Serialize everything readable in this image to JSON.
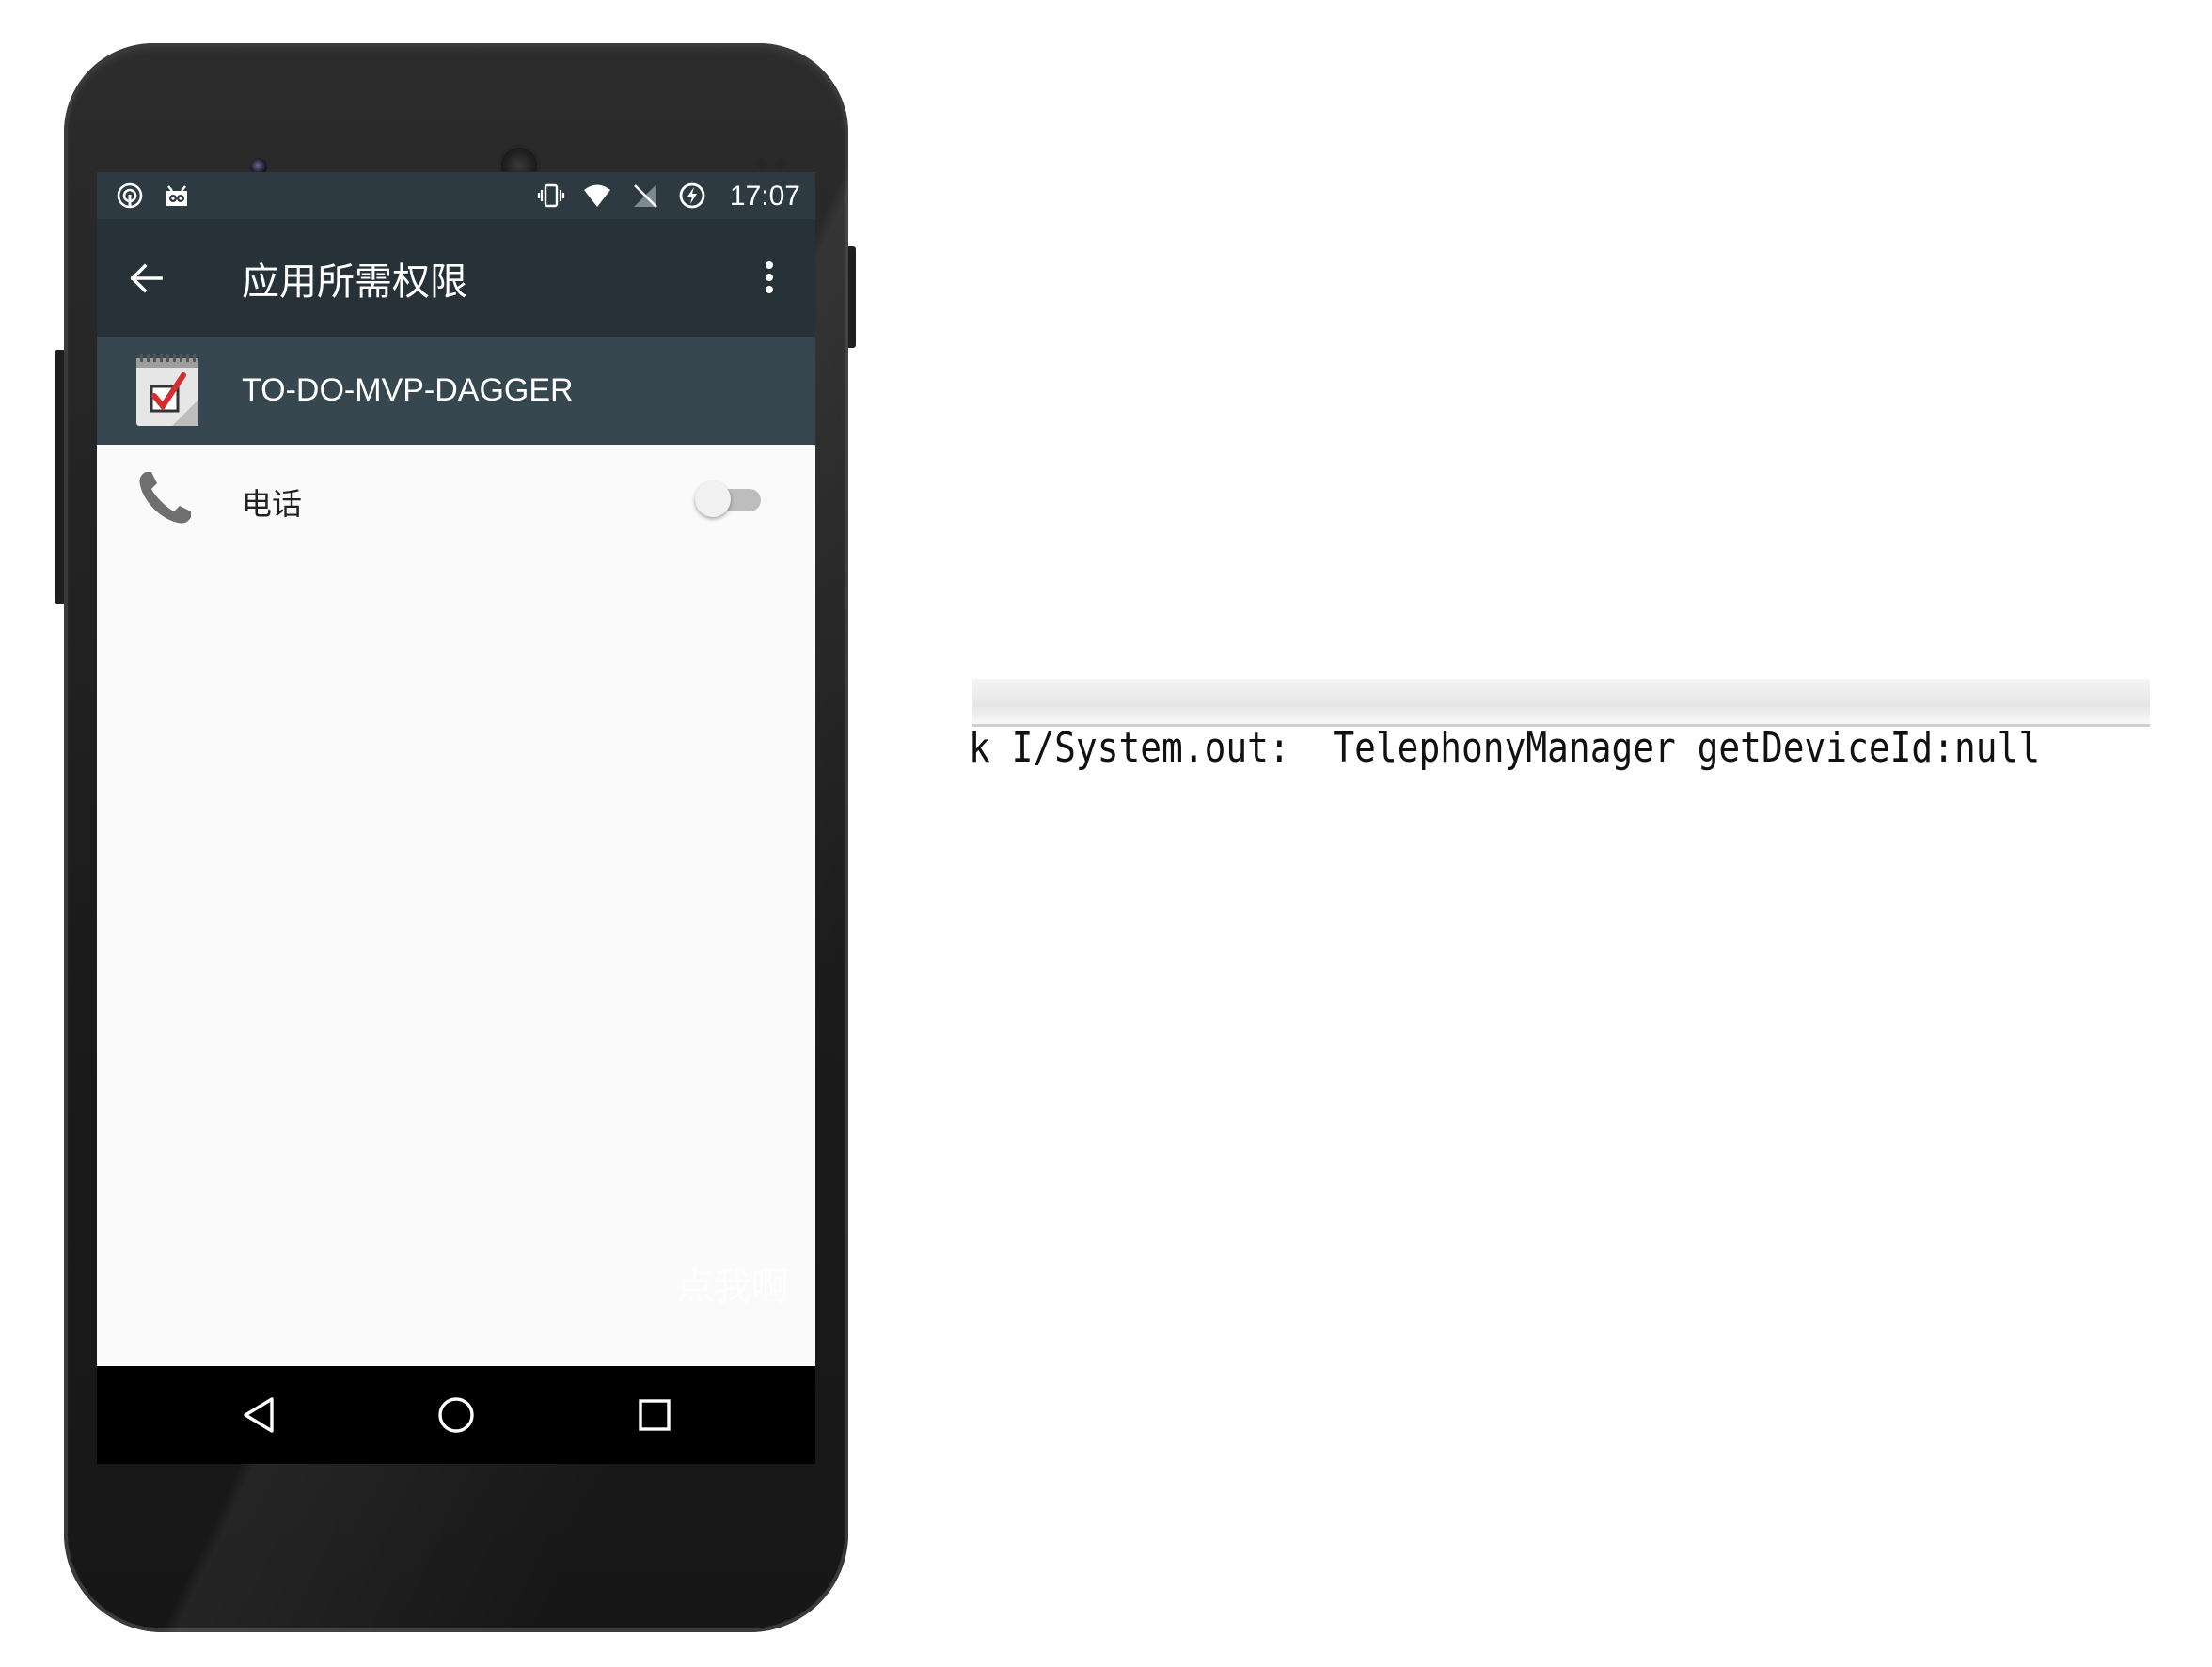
{
  "status_bar": {
    "left_icons": [
      "hotspot-icon",
      "android-debug-icon"
    ],
    "right_icons": [
      "vibrate-icon",
      "wifi-icon",
      "no-sim-icon",
      "data-saver-icon"
    ],
    "time": "17:07"
  },
  "toolbar": {
    "title": "应用所需权限",
    "back_icon": "arrow-left-icon",
    "overflow_icon": "more-vert-icon"
  },
  "app": {
    "name": "TO-DO-MVP-DAGGER",
    "icon": "checklist-app-icon"
  },
  "permissions": [
    {
      "label": "电话",
      "icon": "phone-icon",
      "enabled": false
    }
  ],
  "watermark": "点我啊",
  "nav_bar": {
    "buttons": [
      "back-triangle-icon",
      "home-circle-icon",
      "recents-square-icon"
    ]
  },
  "log": {
    "tag_prefix": "k",
    "tag": "I/System.out",
    "separator": ":",
    "message": "TelephonyManager getDeviceId:null"
  },
  "colors": {
    "status_bar": "#2e3a41",
    "toolbar": "#263238",
    "app_row": "#37474f",
    "screen_bg": "#fafafa",
    "nav_bar": "#000000"
  }
}
